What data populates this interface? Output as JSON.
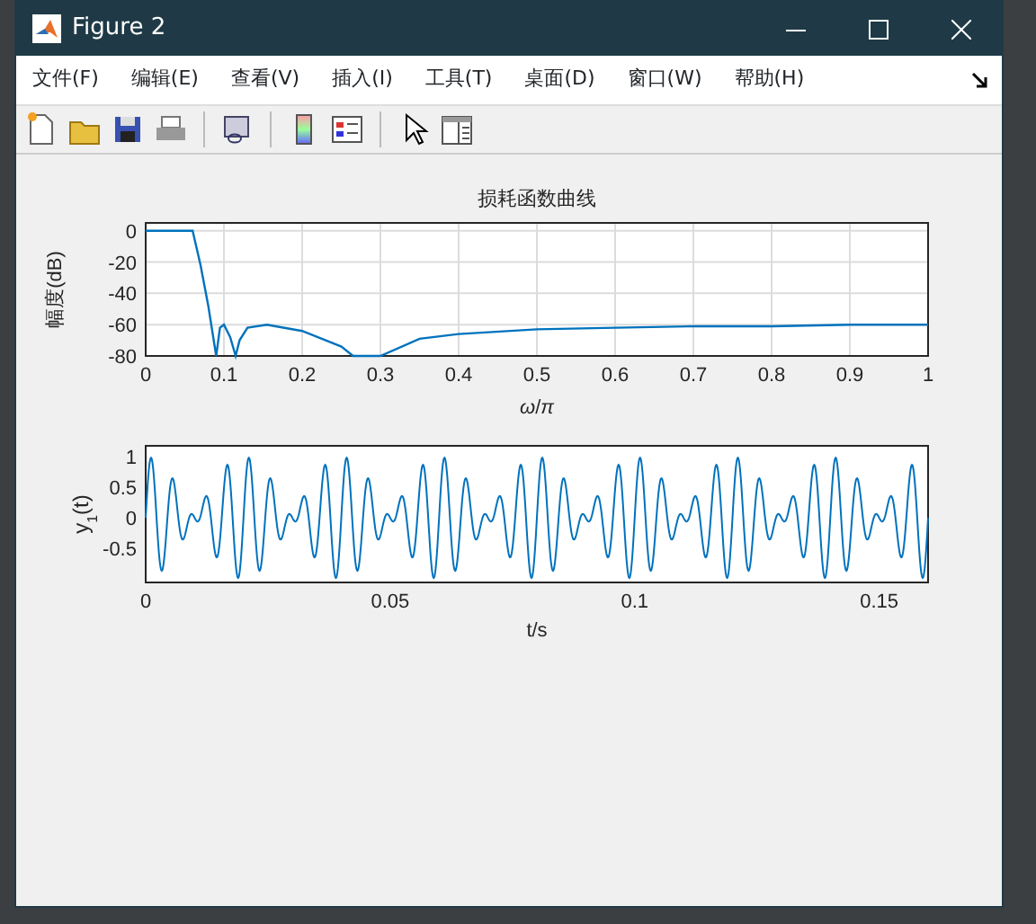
{
  "window": {
    "title": "Figure 2"
  },
  "menu": [
    "文件(F)",
    "编辑(E)",
    "查看(V)",
    "插入(I)",
    "工具(T)",
    "桌面(D)",
    "窗口(W)",
    "帮助(H)"
  ],
  "toolbar": [
    {
      "kind": "new"
    },
    {
      "kind": "open"
    },
    {
      "kind": "save"
    },
    {
      "kind": "print"
    },
    {
      "kind": "sep"
    },
    {
      "kind": "link"
    },
    {
      "kind": "sep"
    },
    {
      "kind": "colorbar"
    },
    {
      "kind": "legend"
    },
    {
      "kind": "sep"
    },
    {
      "kind": "pointer"
    },
    {
      "kind": "property"
    }
  ],
  "plot_1": {
    "chart_data": {
      "type": "line",
      "title": "损耗函数曲线",
      "xlabel": "*ω*/*π*",
      "ylabel": "幅度(dB)",
      "x": [
        0,
        0.02,
        0.04,
        0.06,
        0.07,
        0.08,
        0.09,
        0.095,
        0.1,
        0.108,
        0.115,
        0.12,
        0.13,
        0.155,
        0.2,
        0.25,
        0.265,
        0.3,
        0.35,
        0.4,
        0.5,
        0.6,
        0.7,
        0.8,
        0.9,
        1
      ],
      "series": [
        {
          "color": "#0072bd",
          "values": [
            0,
            0,
            0,
            0,
            -22,
            -48,
            -80,
            -62,
            -60,
            -68,
            -80,
            -70,
            -62,
            -60,
            -64,
            -74,
            -80,
            -80,
            -69,
            -66,
            -63,
            -62,
            -61,
            -61,
            -60,
            -60
          ]
        }
      ],
      "grid": true,
      "xlim": [
        0,
        1
      ],
      "ylim": [
        -80,
        5
      ],
      "xticks": [
        0,
        0.1,
        0.2,
        0.3,
        0.4,
        0.5,
        0.6,
        0.7,
        0.8,
        0.9,
        1
      ],
      "yticks": [
        -80,
        -60,
        -40,
        -20,
        0
      ]
    }
  },
  "plot_2": {
    "ylabel": "y$_{1}$(t)",
    "xlabel": "t/s",
    "x_tick_labels": [
      "0",
      "0.05",
      "0.1",
      "0.15"
    ],
    "y_tick_labels": [
      "1",
      "0.5",
      "0",
      "-0.5"
    ]
  }
}
